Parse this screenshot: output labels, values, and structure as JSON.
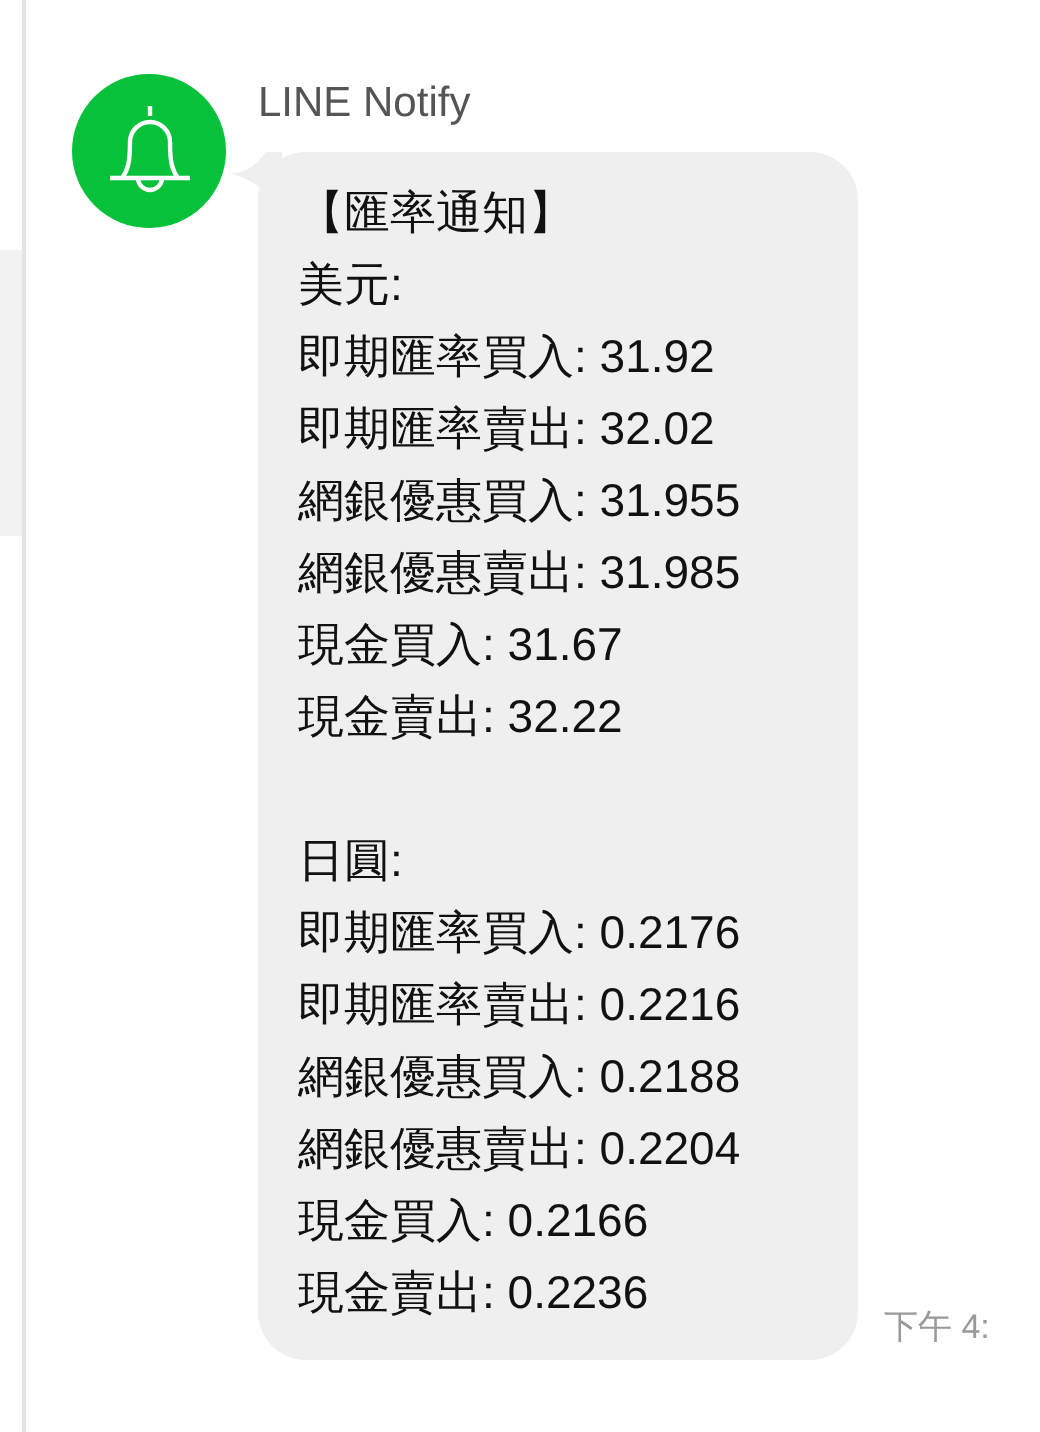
{
  "sender": {
    "name": "LINE Notify"
  },
  "message": {
    "sections": [
      {
        "lines": [
          "【匯率通知】",
          "美元:",
          "即期匯率買入: 31.92",
          "即期匯率賣出: 32.02",
          "網銀優惠買入: 31.955",
          "網銀優惠賣出: 31.985",
          "現金買入: 31.67",
          "現金賣出: 32.22"
        ]
      },
      {
        "lines": [
          "日圓:",
          "即期匯率買入: 0.2176",
          "即期匯率賣出: 0.2216",
          "網銀優惠買入: 0.2188",
          "網銀優惠賣出: 0.2204",
          "現金買入: 0.2166",
          "現金賣出: 0.2236"
        ]
      }
    ],
    "time": "下午 4:"
  }
}
